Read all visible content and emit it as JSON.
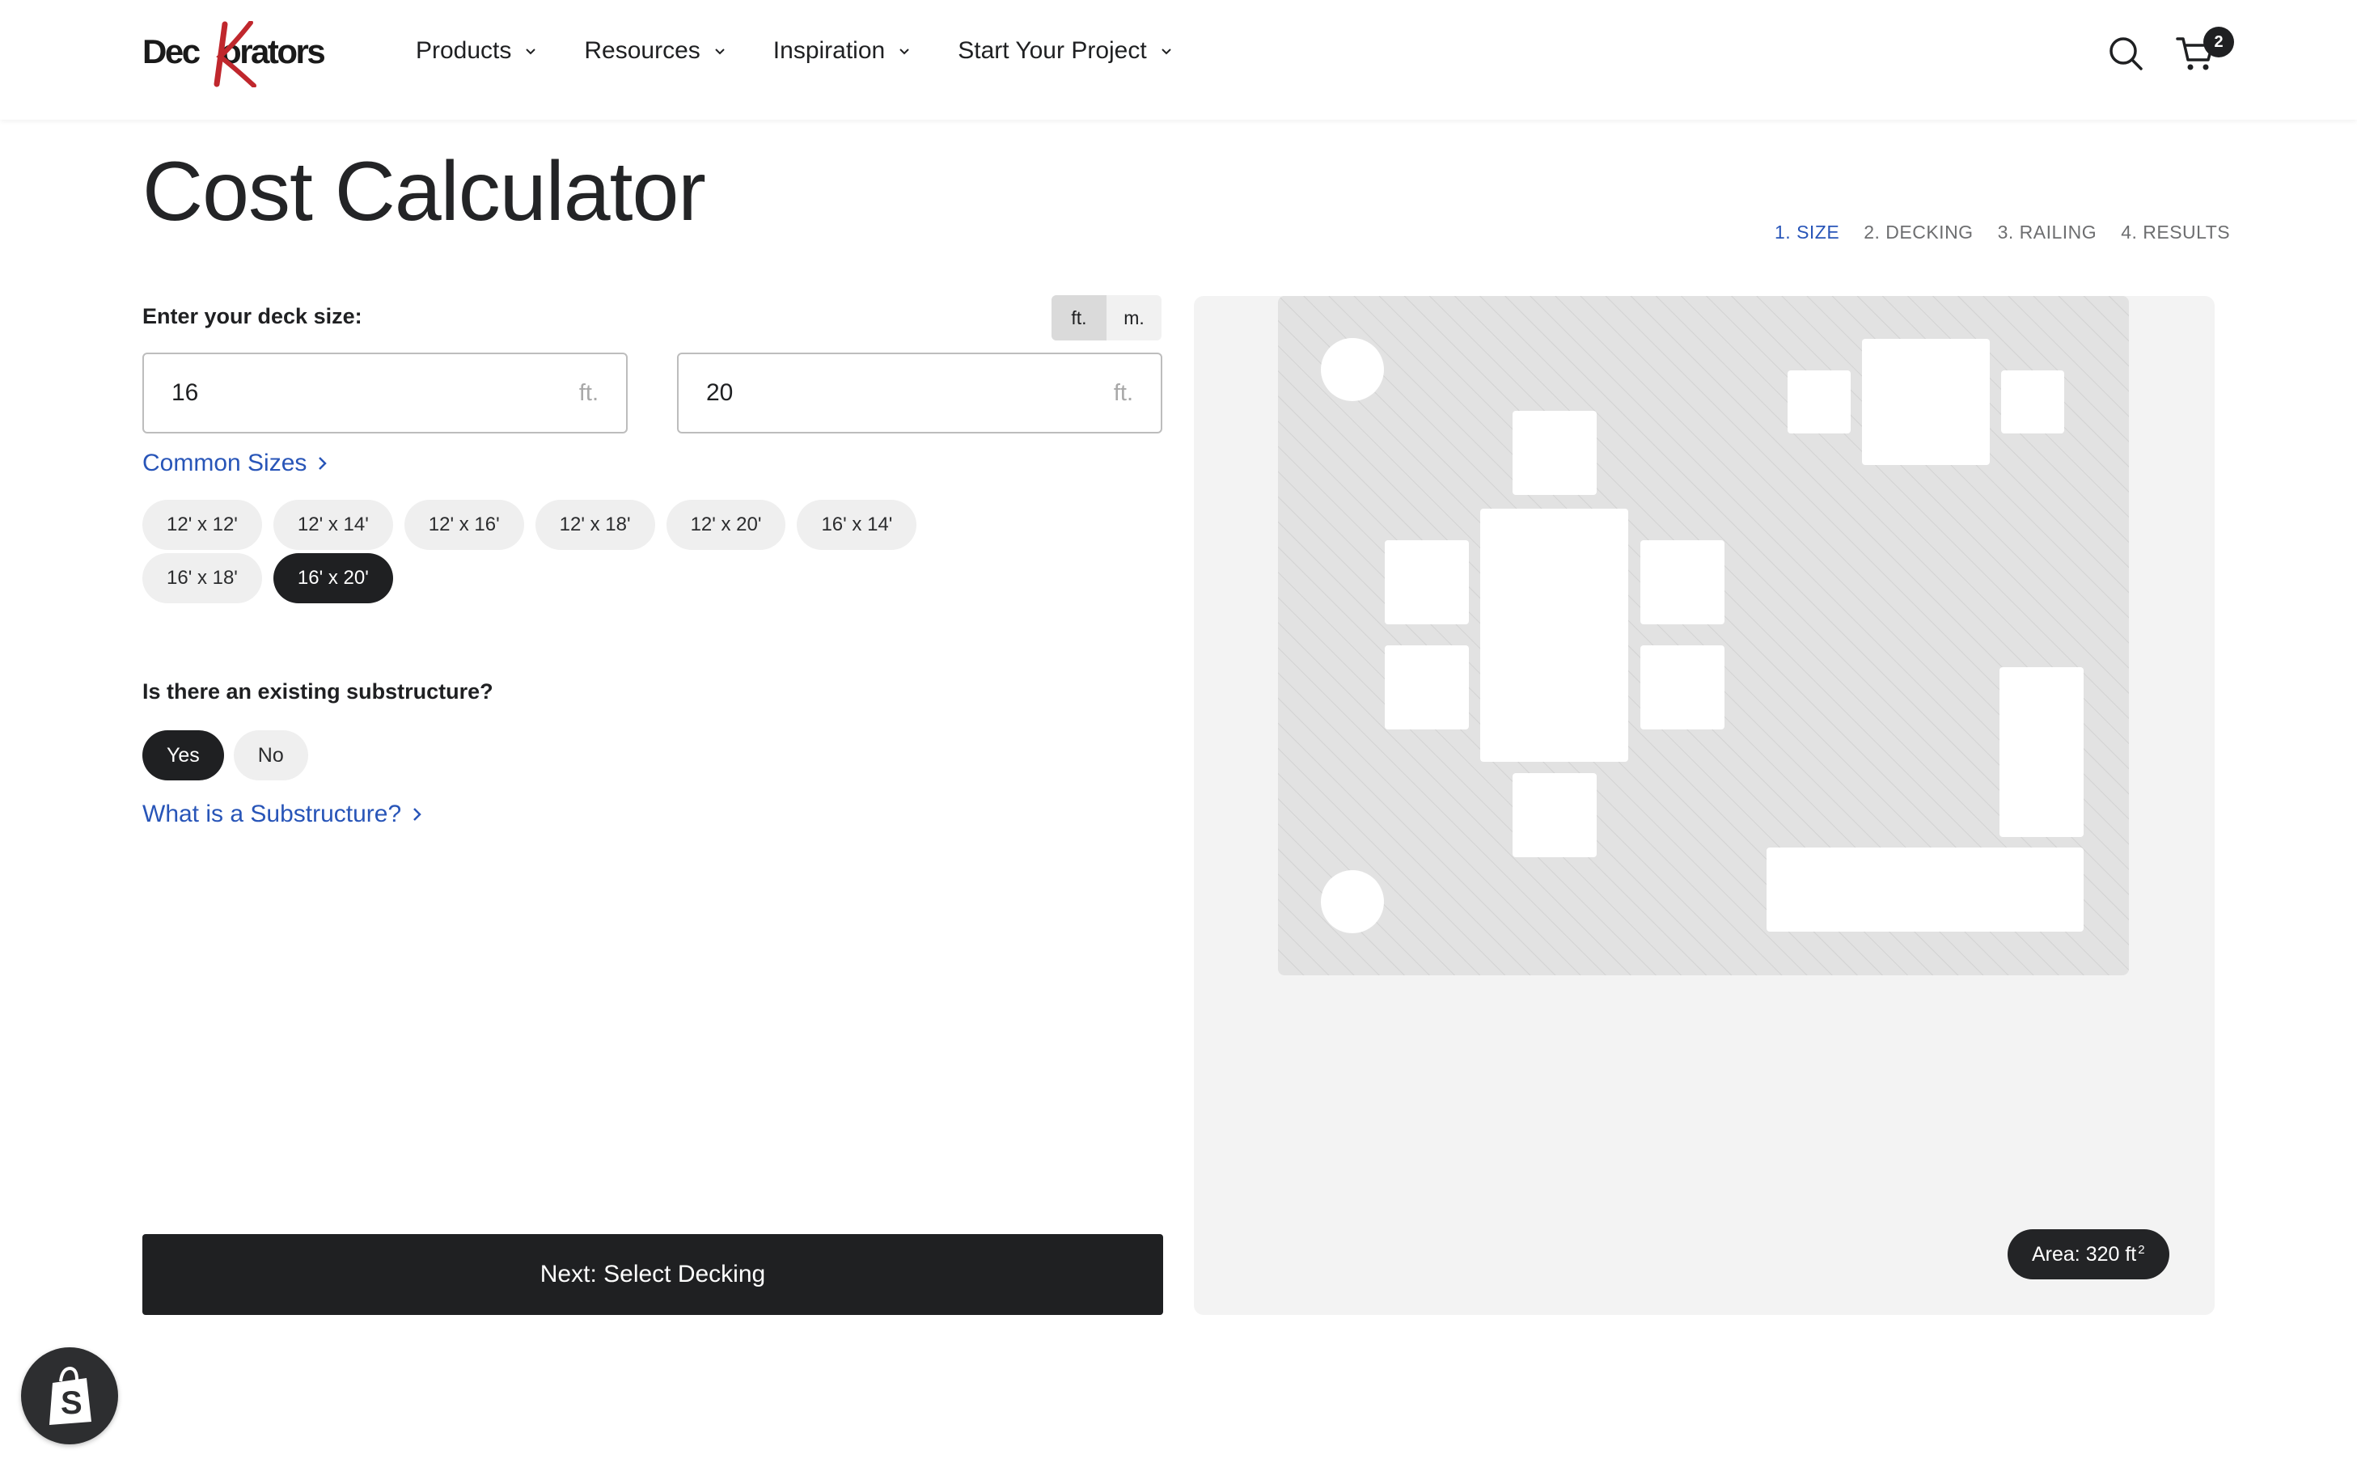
{
  "header": {
    "logo_text": "Deckorators",
    "nav": [
      {
        "label": "Products"
      },
      {
        "label": "Resources"
      },
      {
        "label": "Inspiration"
      },
      {
        "label": "Start Your Project"
      }
    ],
    "cart_count": "2"
  },
  "page": {
    "title": "Cost Calculator",
    "steps": [
      "1. SIZE",
      "2. DECKING",
      "3. RAILING",
      "4. RESULTS"
    ],
    "active_step": 0
  },
  "deck_size": {
    "label": "Enter your deck size:",
    "units": [
      "ft.",
      "m."
    ],
    "selected_unit": "ft.",
    "width": {
      "value": "16",
      "unit": "ft."
    },
    "length": {
      "value": "20",
      "unit": "ft."
    }
  },
  "common_sizes": {
    "link_label": "Common Sizes",
    "options": [
      "12' x 12'",
      "12' x 14'",
      "12' x 16'",
      "12' x 18'",
      "12' x 20'",
      "16' x 14'",
      "16' x 18'",
      "16' x 20'"
    ],
    "selected": "16' x 20'"
  },
  "substructure": {
    "question": "Is there an existing substructure?",
    "options": [
      "Yes",
      "No"
    ],
    "selected": "Yes",
    "help_link": "What is a Substructure?"
  },
  "next_button": "Next: Select Decking",
  "preview": {
    "area_label": "Area: 320 ft",
    "area_sup": "2"
  },
  "colors": {
    "accent_blue": "#2855b8",
    "dark": "#1f2022",
    "chip_bg": "#efefef",
    "preview_bg": "#f3f3f3"
  }
}
